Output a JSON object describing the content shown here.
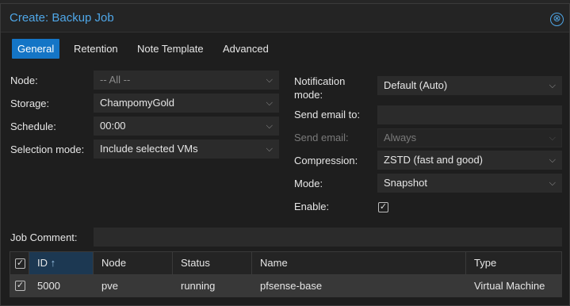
{
  "dialog": {
    "title": "Create: Backup Job",
    "close_symbol": "⊗"
  },
  "tabs": [
    {
      "label": "General",
      "active": true
    },
    {
      "label": "Retention",
      "active": false
    },
    {
      "label": "Note Template",
      "active": false
    },
    {
      "label": "Advanced",
      "active": false
    }
  ],
  "left": {
    "node": {
      "label": "Node:",
      "value": "-- All --"
    },
    "storage": {
      "label": "Storage:",
      "value": "ChampomyGold"
    },
    "schedule": {
      "label": "Schedule:",
      "value": "00:00"
    },
    "selection_mode": {
      "label": "Selection mode:",
      "value": "Include selected VMs"
    },
    "job_comment": {
      "label": "Job Comment:",
      "value": ""
    }
  },
  "right": {
    "notification_mode": {
      "label_line1": "Notification",
      "label_line2": "mode:",
      "value": "Default (Auto)"
    },
    "send_email_to": {
      "label": "Send email to:",
      "value": ""
    },
    "send_email": {
      "label": "Send email:",
      "value": "Always"
    },
    "compression": {
      "label": "Compression:",
      "value": "ZSTD (fast and good)"
    },
    "mode": {
      "label": "Mode:",
      "value": "Snapshot"
    },
    "enable": {
      "label": "Enable:",
      "checked": true
    }
  },
  "grid": {
    "columns": [
      "ID",
      "Node",
      "Status",
      "Name",
      "Type"
    ],
    "sort_indicator": "↑",
    "rows": [
      {
        "selected": true,
        "id": "5000",
        "node": "pve",
        "status": "running",
        "name": "pfsense-base",
        "type": "Virtual Machine"
      }
    ]
  },
  "glyphs": {
    "chevron": "⌵",
    "check": "✓"
  }
}
